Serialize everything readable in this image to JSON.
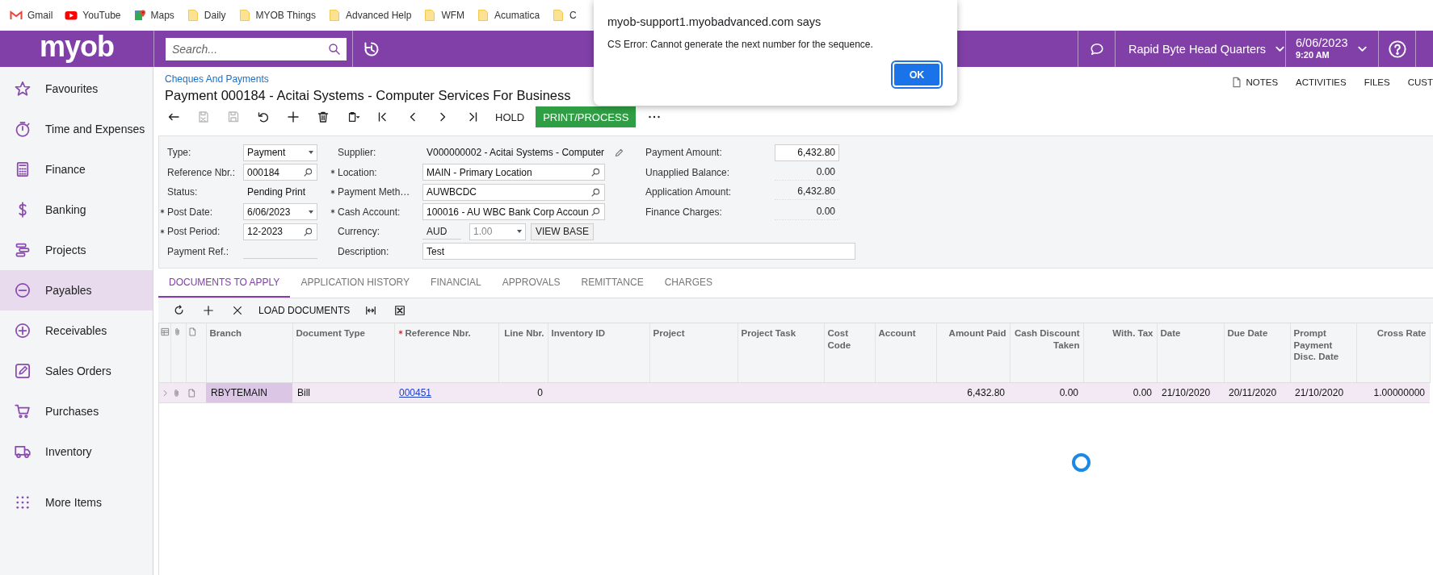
{
  "bookmarks": [
    {
      "label": "Gmail",
      "kind": "gmail"
    },
    {
      "label": "YouTube",
      "kind": "youtube"
    },
    {
      "label": "Maps",
      "kind": "maps"
    },
    {
      "label": "Daily",
      "kind": "folder"
    },
    {
      "label": "MYOB Things",
      "kind": "folder"
    },
    {
      "label": "Advanced Help",
      "kind": "folder"
    },
    {
      "label": "WFM",
      "kind": "folder"
    },
    {
      "label": "Acumatica",
      "kind": "folder"
    },
    {
      "label": "C",
      "kind": "folder"
    }
  ],
  "dialog": {
    "title": "myob-support1.myobadvanced.com says",
    "message": "CS Error: Cannot generate the next number for the sequence.",
    "button": "OK"
  },
  "header": {
    "logo": "myob",
    "search": {
      "placeholder": "Search..."
    },
    "company": "Rapid Byte Head Quarters",
    "date": "6/06/2023",
    "time": "9:20 AM"
  },
  "sidebar": {
    "items": [
      {
        "label": "Favourites",
        "selected": false
      },
      {
        "label": "Time and Expenses",
        "selected": false
      },
      {
        "label": "Finance",
        "selected": false
      },
      {
        "label": "Banking",
        "selected": false
      },
      {
        "label": "Projects",
        "selected": false
      },
      {
        "label": "Payables",
        "selected": true
      },
      {
        "label": "Receivables",
        "selected": false
      },
      {
        "label": "Sales Orders",
        "selected": false
      },
      {
        "label": "Purchases",
        "selected": false
      },
      {
        "label": "Inventory",
        "selected": false
      },
      {
        "label": "More Items",
        "selected": false
      }
    ]
  },
  "screen": {
    "breadcrumb": "Cheques And Payments",
    "title": "Payment 000184 - Acitai Systems - Computer Services For Business",
    "links": [
      {
        "label": "NOTES",
        "kind": "icon-text"
      },
      {
        "label": "ACTIVITIES",
        "kind": "text"
      },
      {
        "label": "FILES",
        "kind": "text"
      },
      {
        "label": "CUST",
        "kind": "text"
      }
    ]
  },
  "toolbar": [
    {
      "kind": "icon",
      "disabled": false
    },
    {
      "kind": "icon",
      "disabled": true
    },
    {
      "kind": "icon",
      "disabled": true
    },
    {
      "kind": "icon",
      "disabled": false
    },
    {
      "kind": "icon",
      "disabled": false
    },
    {
      "kind": "icon",
      "disabled": false
    },
    {
      "kind": "icon",
      "disabled": false
    },
    {
      "kind": "icon",
      "disabled": false
    },
    {
      "kind": "icon",
      "disabled": false
    },
    {
      "kind": "icon",
      "disabled": false
    },
    {
      "kind": "icon",
      "disabled": false
    },
    {
      "kind": "text",
      "label": "HOLD"
    },
    {
      "kind": "primary",
      "label": "PRINT/PROCESS"
    },
    {
      "kind": "icon",
      "disabled": false
    }
  ],
  "form": {
    "columns": [
      [
        {
          "label": "Type:",
          "required": false,
          "kind": "select",
          "value": "Payment"
        },
        {
          "label": "Reference Nbr.:",
          "required": false,
          "kind": "lookup",
          "value": "000184"
        },
        {
          "label": "Status:",
          "required": false,
          "kind": "display",
          "value": "Pending Print"
        },
        {
          "label": "Post Date:",
          "required": true,
          "kind": "select",
          "value": "6/06/2023"
        },
        {
          "label": "Post Period:",
          "required": true,
          "kind": "lookup",
          "value": "12-2023"
        },
        {
          "label": "Payment Ref.:",
          "required": false,
          "kind": "blank"
        }
      ],
      [
        {
          "label": "Supplier:",
          "required": false,
          "kind": "display-edit",
          "value": "V000000002 - Acitai Systems - Computer"
        },
        {
          "label": "Location:",
          "required": true,
          "kind": "lookup",
          "value": "MAIN - Primary Location"
        },
        {
          "label": "Payment Meth…",
          "required": true,
          "kind": "lookup",
          "value": "AUWBCDC"
        },
        {
          "label": "Cash Account:",
          "required": true,
          "kind": "lookup",
          "value": "100016 - AU WBC Bank Corp Accoun"
        },
        {
          "label": "Currency:",
          "required": false,
          "kind": "currency",
          "value": "AUD",
          "rate": "1.00",
          "rate_disabled": true,
          "button": "VIEW BASE"
        },
        {
          "label": "Description:",
          "required": false,
          "kind": "text-wide",
          "value": "Test"
        }
      ],
      [
        {
          "label": "Payment Amount:",
          "required": false,
          "kind": "number",
          "value": "6,432.80"
        },
        {
          "label": "Unapplied Balance:",
          "required": false,
          "kind": "display-number",
          "value": "0.00"
        },
        {
          "label": "Application Amount:",
          "required": false,
          "kind": "display-number",
          "value": "6,432.80"
        },
        {
          "label": "Finance Charges:",
          "required": false,
          "kind": "display-number",
          "value": "0.00"
        }
      ]
    ]
  },
  "tabs": [
    {
      "label": "DOCUMENTS TO APPLY",
      "selected": true
    },
    {
      "label": "APPLICATION HISTORY",
      "selected": false
    },
    {
      "label": "FINANCIAL",
      "selected": false
    },
    {
      "label": "APPROVALS",
      "selected": false
    },
    {
      "label": "REMITTANCE",
      "selected": false
    },
    {
      "label": "CHARGES",
      "selected": false
    }
  ],
  "grid_toolbar": [
    {
      "kind": "icon"
    },
    {
      "kind": "icon"
    },
    {
      "kind": "icon"
    },
    {
      "kind": "text",
      "label": "LOAD DOCUMENTS"
    },
    {
      "kind": "icon"
    },
    {
      "kind": "icon"
    }
  ],
  "grid": {
    "columns": [
      {
        "kind": "icon"
      },
      {
        "kind": "icon"
      },
      {
        "kind": "icon"
      },
      {
        "kind": "text",
        "label": "Branch",
        "required": false
      },
      {
        "kind": "text",
        "label": "Document Type",
        "required": false
      },
      {
        "kind": "link",
        "label": "Reference Nbr.",
        "required": true
      },
      {
        "kind": "text",
        "label": "Line Nbr.",
        "required": false
      },
      {
        "kind": "text",
        "label": "Inventory ID",
        "required": false
      },
      {
        "kind": "text",
        "label": "Project",
        "required": false
      },
      {
        "kind": "text",
        "label": "Project Task",
        "required": false
      },
      {
        "kind": "text",
        "label": "Cost Code",
        "required": false
      },
      {
        "kind": "text",
        "label": "Account",
        "required": false
      },
      {
        "kind": "text",
        "label": "Amount Paid",
        "required": false
      },
      {
        "kind": "text",
        "label": "Cash Discount Taken",
        "required": false
      },
      {
        "kind": "text",
        "label": "With. Tax",
        "required": false
      },
      {
        "kind": "text",
        "label": "Date",
        "required": false
      },
      {
        "kind": "text",
        "label": "Due Date",
        "required": false
      },
      {
        "kind": "text",
        "label": "Prompt Payment Disc. Date",
        "required": false
      },
      {
        "kind": "text",
        "label": "Cross Rate",
        "required": false
      }
    ],
    "rows": [
      {
        "selected": true,
        "cells": [
          {
            "focused": false
          },
          {
            "focused": false
          },
          {
            "focused": false
          },
          {
            "text": "RBYTEMAIN",
            "focused": true
          },
          {
            "text": "Bill",
            "focused": false
          },
          {
            "text": "000451",
            "focused": false
          },
          {
            "text": "0",
            "focused": false
          },
          {
            "focused": false
          },
          {
            "focused": false
          },
          {
            "focused": false
          },
          {
            "focused": false
          },
          {
            "focused": false
          },
          {
            "text": "6,432.80",
            "focused": false
          },
          {
            "text": "0.00",
            "focused": false
          },
          {
            "text": "0.00",
            "focused": false
          },
          {
            "text": "21/10/2020",
            "focused": false
          },
          {
            "text": "20/11/2020",
            "focused": false
          },
          {
            "text": "21/10/2020",
            "focused": false
          },
          {
            "text": "1.00000000",
            "focused": false
          }
        ]
      }
    ]
  }
}
